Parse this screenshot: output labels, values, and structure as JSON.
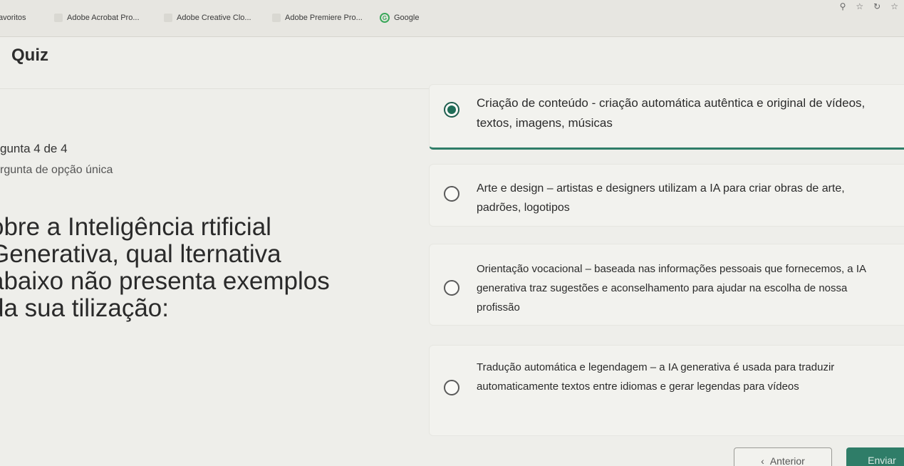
{
  "browser": {
    "bookmarks": [
      {
        "label": "avoritos",
        "icon": "folder-icon"
      },
      {
        "label": "Adobe Acrobat Pro...",
        "icon": "acrobat-icon"
      },
      {
        "label": "Adobe Creative Clo...",
        "icon": "creative-cloud-icon"
      },
      {
        "label": "Adobe Premiere Pro...",
        "icon": "premiere-icon"
      },
      {
        "label": "Google",
        "icon": "google-icon"
      }
    ],
    "toolbar_icons": [
      "zoom-icon",
      "star-icon",
      "refresh-icon",
      "bookmark-icon"
    ]
  },
  "header": {
    "title": "Quiz"
  },
  "question": {
    "counter": "gunta 4 de 4",
    "type": "rgunta de opção única",
    "text": "obre a Inteligência rtificial Generativa, qual lternativa abaixo não presenta exemplos da sua tilização:"
  },
  "options": [
    {
      "text": "Criação de conteúdo - criação automática autêntica e original de vídeos, textos, imagens, músicas",
      "selected": true
    },
    {
      "text": "Arte e design – artistas e designers utilizam a IA para criar obras de arte, padrões, logotipos",
      "selected": false
    },
    {
      "text": "Orientação vocacional – baseada nas informações pessoais que fornecemos, a IA generativa traz sugestões e aconselhamento para ajudar na escolha de nossa profissão",
      "selected": false
    },
    {
      "text": "Tradução automática e legendagem – a IA generativa é usada para traduzir automaticamente textos entre idiomas e gerar legendas para vídeos",
      "selected": false
    }
  ],
  "footer": {
    "prev_label": "Anterior",
    "send_label": "Enviar"
  },
  "colors": {
    "accent": "#2f7d68",
    "background": "#eeeeea"
  }
}
